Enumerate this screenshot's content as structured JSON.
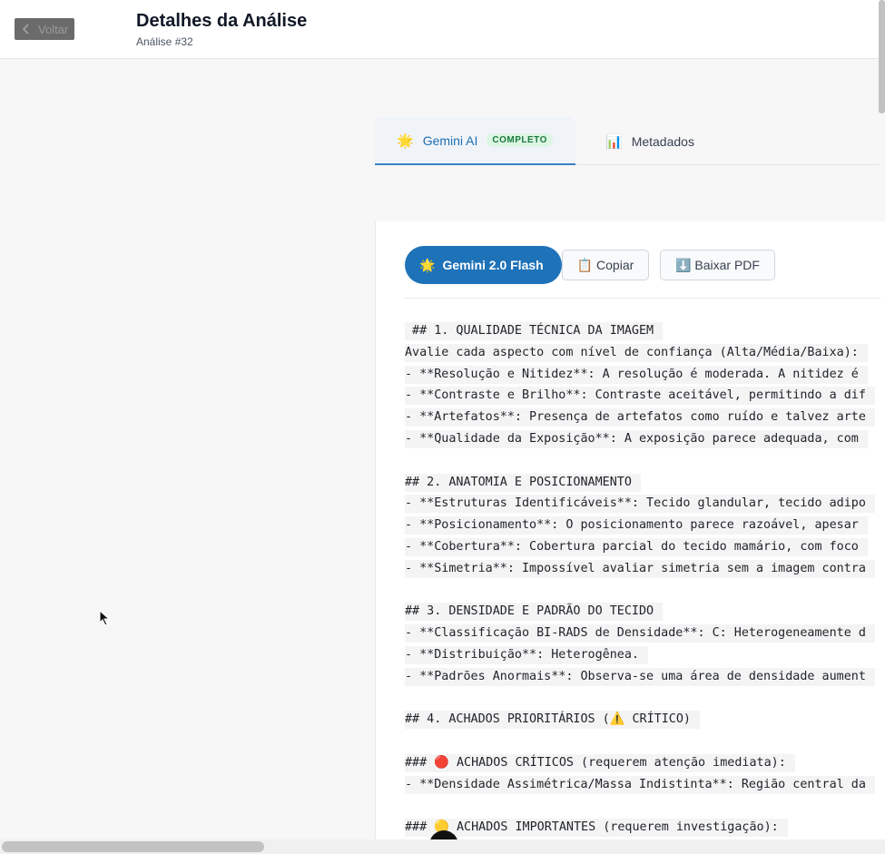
{
  "header": {
    "back_label": "Voltar",
    "title": "Detalhes da Análise",
    "subtitle": "Análise #32"
  },
  "tabs": [
    {
      "icon": "🌟",
      "label": "Gemini AI",
      "badge": "COMPLETO",
      "active": true
    },
    {
      "icon": "📊",
      "label": "Metadados",
      "active": false
    }
  ],
  "toolbar": {
    "model_icon": "🌟",
    "model_label": "Gemini 2.0 Flash",
    "copy_label": "📋 Copiar",
    "pdf_label": "⬇️ Baixar PDF"
  },
  "report_lines": [
    " ## 1. QUALIDADE TÉCNICA DA IMAGEM",
    "Avalie cada aspecto com nível de confiança (Alta/Média/Baixa):",
    "- **Resolução e Nitidez**: A resolução é moderada. A nitidez é",
    "- **Contraste e Brilho**: Contraste aceitável, permitindo a dif",
    "- **Artefatos**: Presença de artefatos como ruído e talvez arte",
    "- **Qualidade da Exposição**: A exposição parece adequada, com",
    "",
    "## 2. ANATOMIA E POSICIONAMENTO",
    "- **Estruturas Identificáveis**: Tecido glandular, tecido adipo",
    "- **Posicionamento**: O posicionamento parece razoável, apesar",
    "- **Cobertura**: Cobertura parcial do tecido mamário, com foco",
    "- **Simetria**: Impossível avaliar simetria sem a imagem contra",
    "",
    "## 3. DENSIDADE E PADRÃO DO TECIDO",
    "- **Classificação BI-RADS de Densidade**: C: Heterogeneamente d",
    "- **Distribuição**: Heterogênea.",
    "- **Padrões Anormais**: Observa-se uma área de densidade aument",
    "",
    "## 4. ACHADOS PRIORITÁRIOS (⚠️ CRÍTICO)",
    "",
    "### 🔴 ACHADOS CRÍTICOS (requerem atenção imediata):",
    "- **Densidade Assimétrica/Massa Indistinta**: Região central da",
    "",
    "### 🟡 ACHADOS IMPORTANTES (requerem investigação):"
  ],
  "colors": {
    "accent": "#1e72b8",
    "badge_bg": "#dcf5e4",
    "badge_text": "#1b7a3d"
  }
}
